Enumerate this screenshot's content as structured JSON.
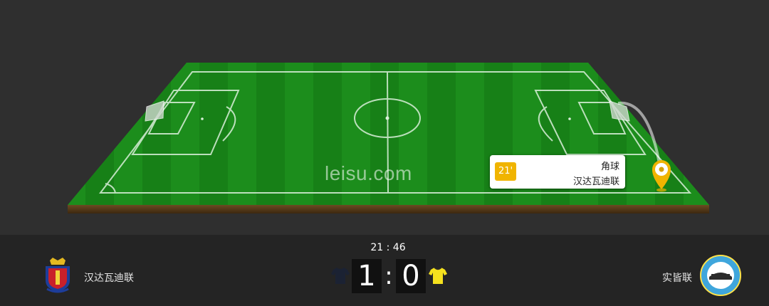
{
  "match": {
    "time": "21 : 46",
    "home": {
      "name": "汉达瓦迪联",
      "score": "1",
      "jersey_color": "#1b2233"
    },
    "away": {
      "name": "实皆联",
      "score": "0",
      "jersey_color": "#f5e11e"
    },
    "separator": ":"
  },
  "event": {
    "minute": "21'",
    "type": "角球",
    "team": "汉达瓦迪联",
    "marker_icon": "ball-marker-icon"
  },
  "pitch": {
    "watermark": "leisu.com",
    "grass_color": "#1a8a1a",
    "line_color": "#d9efd9"
  },
  "colors": {
    "accent": "#f0b400",
    "background_top": "#2f2f2f",
    "background_bottom": "#242424"
  }
}
